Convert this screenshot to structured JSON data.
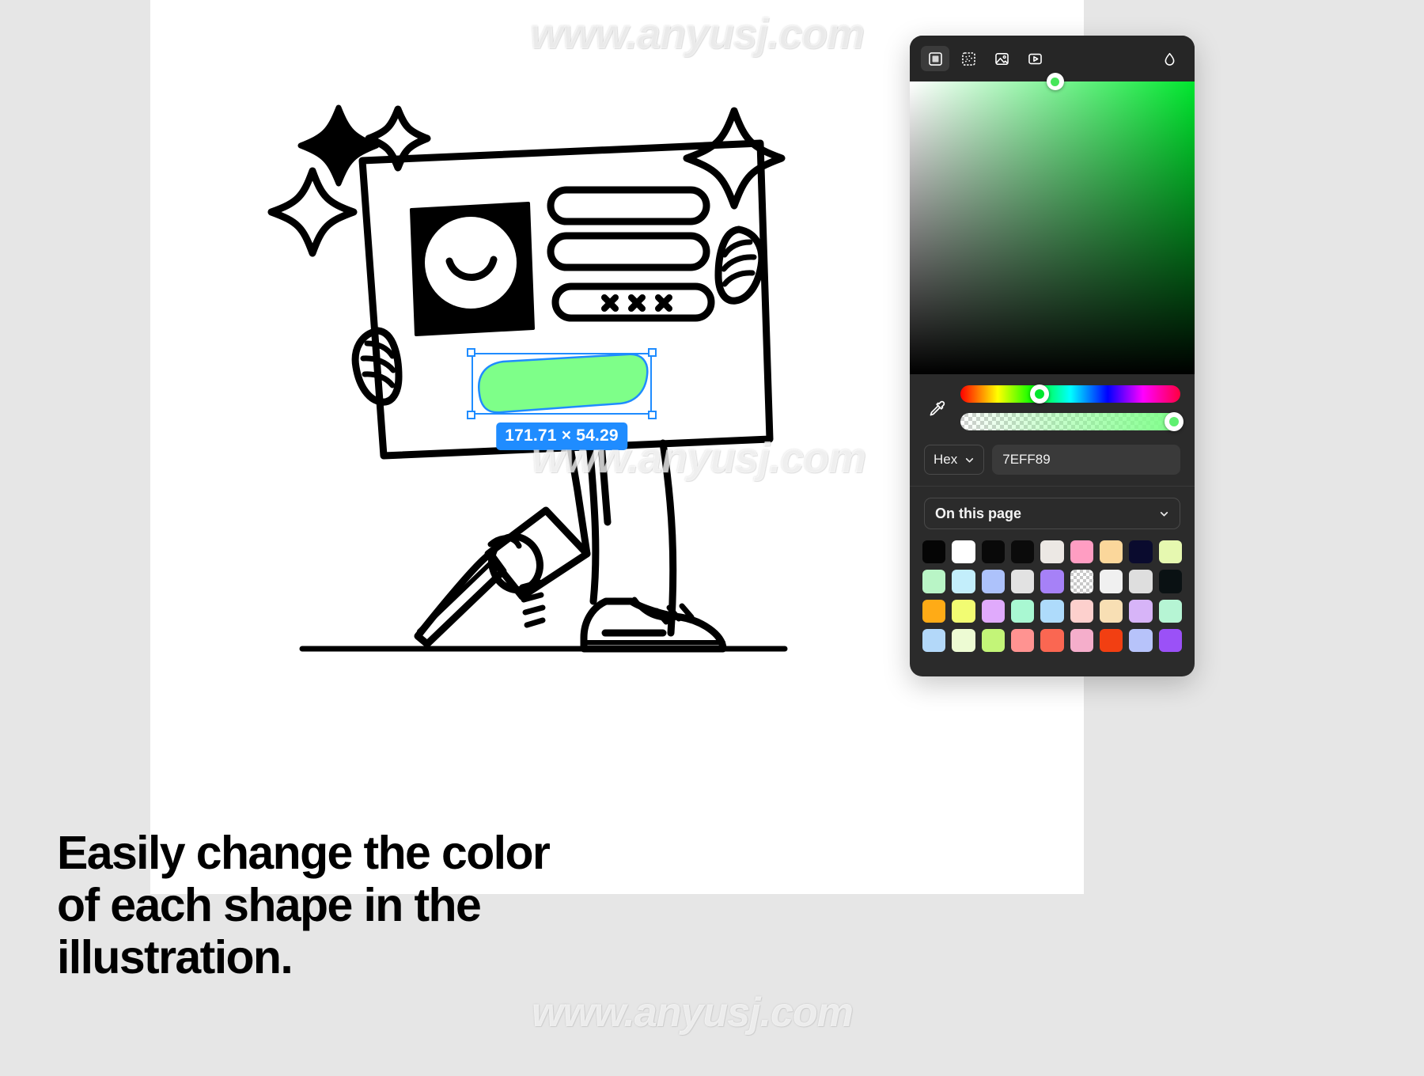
{
  "watermark": {
    "text": "www.anyusj.com"
  },
  "caption": {
    "line1": "Easily change the color",
    "line2": "of each shape in the",
    "line3": "illustration."
  },
  "selection": {
    "dimensions_label": "171.71 × 54.29",
    "width": "171.71",
    "height": "54.29",
    "accent_color": "#1f8cff",
    "shape_fill": "#7eff89"
  },
  "picker": {
    "toolbar": {
      "items": [
        {
          "icon": "solid-fill-icon",
          "label": "Solid",
          "active": true
        },
        {
          "icon": "gradient-noise-icon",
          "label": "Noise",
          "active": false
        },
        {
          "icon": "image-fill-icon",
          "label": "Image",
          "active": false
        },
        {
          "icon": "video-fill-icon",
          "label": "Video",
          "active": false
        }
      ],
      "right_icon": "blend-drop-icon"
    },
    "eyedropper_icon": "eyedropper-icon",
    "format": {
      "label": "Hex",
      "chevron_icon": "chevron-down-icon"
    },
    "hex_value": "7EFF89",
    "alpha_value": "100",
    "alpha_unit": "%",
    "scope": {
      "label": "On this page",
      "chevron_icon": "chevron-down-icon"
    },
    "swatches": [
      "#050505",
      "#ffffff",
      "#090909",
      "#0b0b0b",
      "#ece8e4",
      "#ff9dc2",
      "#fbd79b",
      "#0a0b2e",
      "#e6f8b0",
      "#b9f5c6",
      "#c3eefb",
      "#adc2fb",
      "#e2e2e2",
      "#a681f7",
      "checker",
      "#f0f0f0",
      "#dedede",
      "#0a1113",
      "#ffab16",
      "#f2fc72",
      "#e0aafc",
      "#a9f8d2",
      "#aedbfb",
      "#fdd0cd",
      "#f8dfb4",
      "#d7b4f8",
      "#b6f5d4",
      "#b3d8f9",
      "#edfbd3",
      "#c3f578",
      "#ff9391",
      "#fa6752",
      "#f5aecb",
      "#f23f12",
      "#b7c3fa",
      "#9b51f7"
    ]
  }
}
